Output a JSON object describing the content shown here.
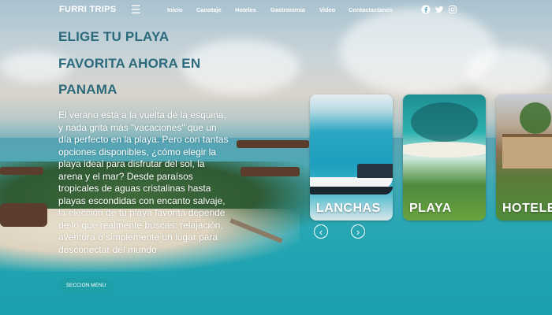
{
  "nav": {
    "brand": "FURRI TRIPS",
    "menu_icon": "hamburger-menu-icon",
    "links": [
      "Inicio",
      "Canotaje",
      "Hoteles",
      "Gastronimia",
      "Video",
      "Contactactanos"
    ],
    "social": [
      "facebook-icon",
      "twitter-icon",
      "instagram-icon"
    ]
  },
  "hero": {
    "title_lines": [
      "ELIGE TU PLAYA",
      "FAVORITA AHORA EN",
      "PANAMA"
    ],
    "intro": "El verano está a la vuelta de la esquina, y nada grita más \"vacaciones\" que un día perfecto en la playa. Pero con tantas opciones disponibles, ¿cómo elegir la playa ideal para disfrutar del sol, la arena y el mar? Desde paraísos tropicales de aguas cristalinas hasta playas escondidas con encanto salvaje, la elección de tu playa favorita depende de lo que realmente buscas: relajación, aventura o simplemente un lugar para desconectar del mundo",
    "button": "SECCION MENU"
  },
  "carousel": {
    "cards": [
      "LANCHAS",
      "PLAYA",
      "HOTELES"
    ],
    "prev_icon": "chevron-left-icon",
    "next_icon": "chevron-right-icon"
  },
  "colors": {
    "title": "#2b6a7c",
    "button": "#1f9fa8"
  }
}
